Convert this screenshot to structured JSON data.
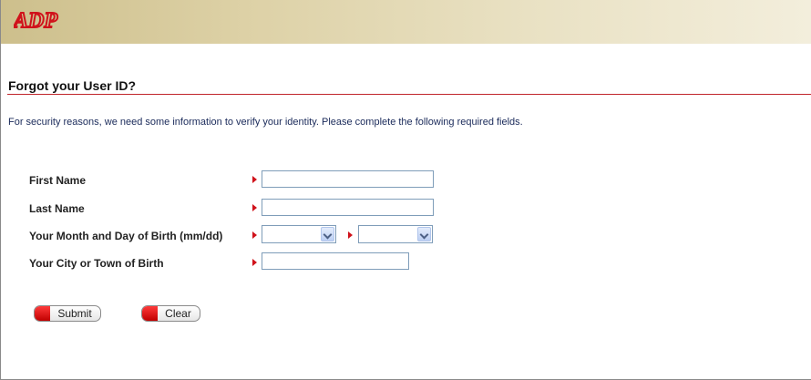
{
  "header": {
    "logo_text": "ADP",
    "logo_color": "#d0121b"
  },
  "page_title": "Forgot your User ID?",
  "intro_text": "For security reasons, we need some information to verify your identity. Please complete the following required fields.",
  "form": {
    "first_name": {
      "label": "First Name",
      "value": ""
    },
    "last_name": {
      "label": "Last Name",
      "value": ""
    },
    "birth": {
      "label": "Your Month and Day of Birth (mm/dd)",
      "month_value": "",
      "day_value": ""
    },
    "city": {
      "label": "Your City or Town of Birth",
      "value": ""
    }
  },
  "buttons": {
    "submit": "Submit",
    "clear": "Clear"
  },
  "colors": {
    "accent": "#c0262b",
    "required_marker": "#d0121b",
    "header_bg": "#d8cca0"
  }
}
